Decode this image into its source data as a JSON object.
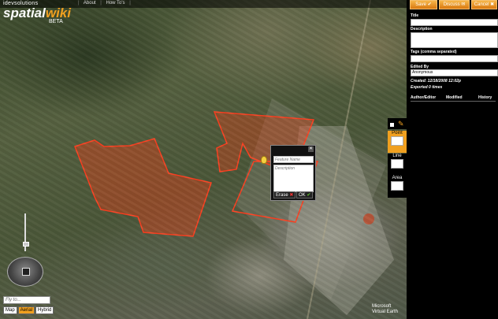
{
  "brand": {
    "top": "idevsolutions",
    "word_a": "spatial",
    "word_b": "wiki",
    "tag": "BETA"
  },
  "top_links": [
    "About",
    "How To's"
  ],
  "popup": {
    "name_placeholder": "Feature Name",
    "desc_placeholder": "Description",
    "erase_label": "Erase",
    "ok_label": "OK",
    "close_glyph": "✕"
  },
  "tools": [
    {
      "label": "Point",
      "active": true
    },
    {
      "label": "Line",
      "active": false
    },
    {
      "label": "Area",
      "active": false
    }
  ],
  "map_controls": {
    "flyto_placeholder": "Fly to...",
    "views": [
      "Map",
      "Aerial",
      "Hybrid"
    ],
    "active_view": "Aerial",
    "provider_a": "Microsoft",
    "provider_b": "Virtual Earth"
  },
  "panel": {
    "buttons": [
      "Save",
      "Discuss",
      "Cancel"
    ],
    "fields": {
      "title_label": "Title",
      "title_value": "",
      "description_label": "Description",
      "description_value": "",
      "tags_label": "Tags (comma separated)",
      "tags_value": "",
      "edited_by_label": "Edited By",
      "edited_by_value": "Anonymous"
    },
    "created": "Created: 12/18/2008 12:02p",
    "exported": "Exported 0 times",
    "history_headers": [
      "Author/Editor",
      "Modified",
      "History"
    ]
  },
  "colors": {
    "accent": "#f0a020",
    "polygon_fill": "#e0401a"
  }
}
